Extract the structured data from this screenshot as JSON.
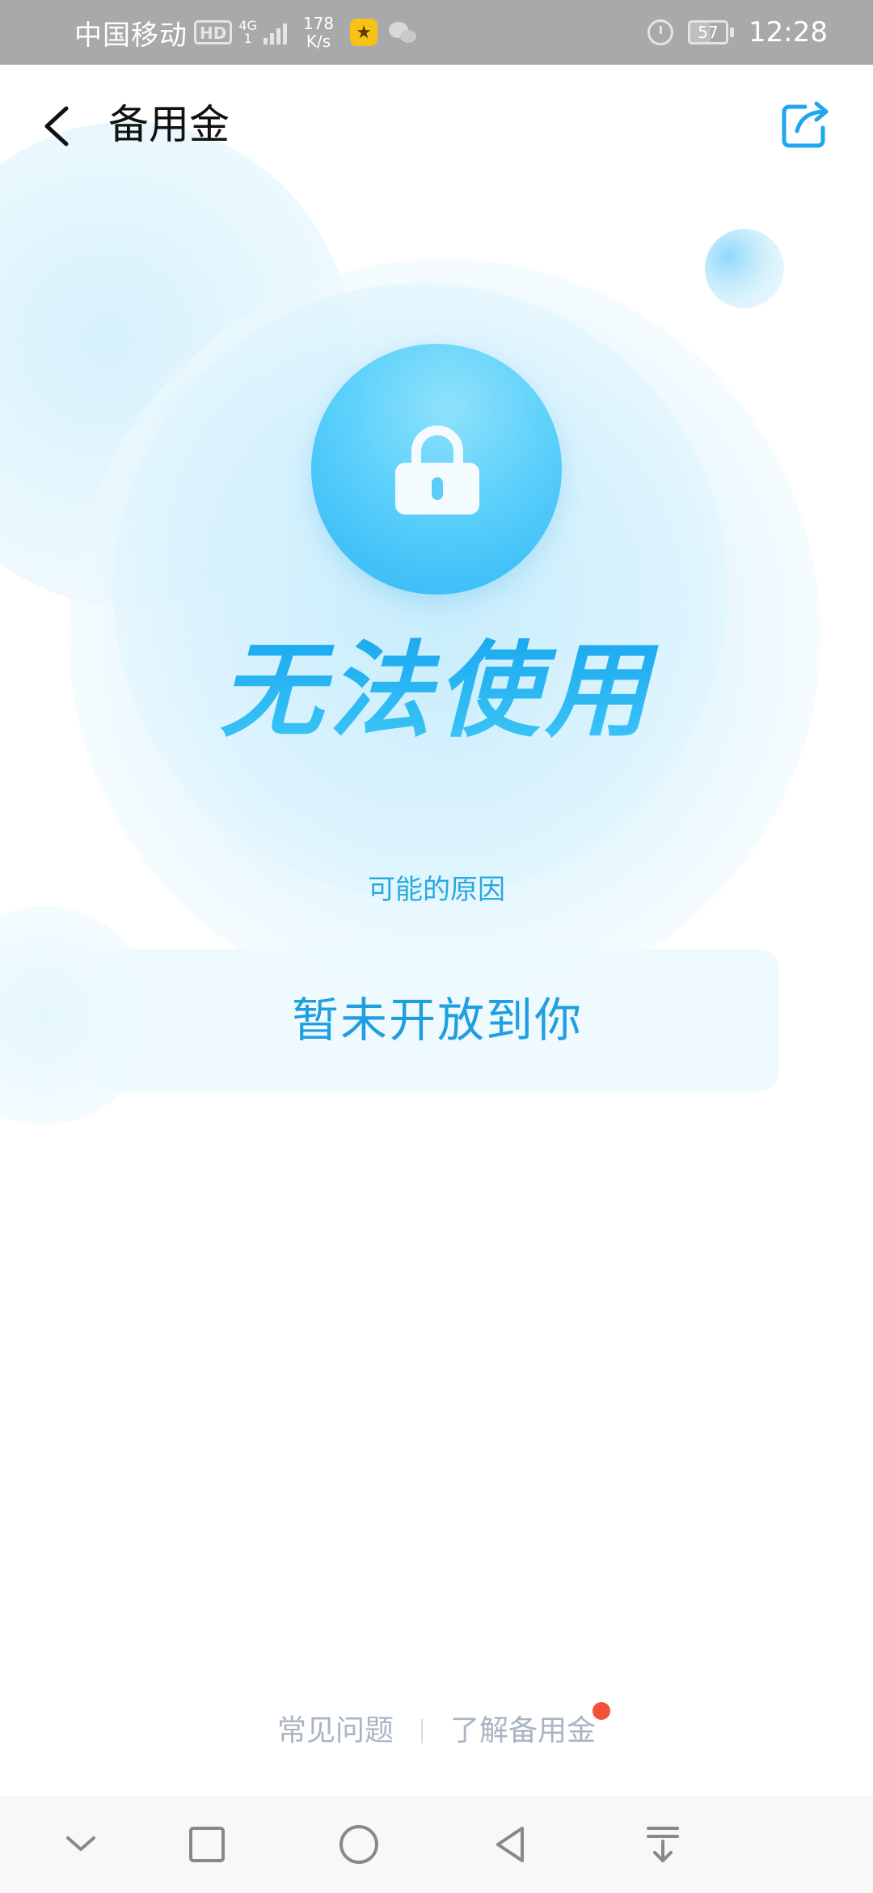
{
  "status_bar": {
    "carrier": "中国移动",
    "hd_badge": "HD",
    "network_type": "4G",
    "network_sub": "1",
    "speed_value": "178",
    "speed_unit": "K/s",
    "battery_level": "57",
    "time": "12:28"
  },
  "header": {
    "title": "备用金"
  },
  "main": {
    "headline": "无法使用",
    "reason_label": "可能的原因",
    "reason_text": "暂未开放到你"
  },
  "footer": {
    "faq_link": "常见问题",
    "learn_link": "了解备用金"
  },
  "colors": {
    "accent": "#2fb8f2",
    "status_bar_bg": "#a9a9ab",
    "reason_text": "#1f9fe0",
    "footer_link": "#a9b5c2",
    "badge_dot": "#f2513c"
  },
  "icons": {
    "back": "chevron-left-icon",
    "share": "share-icon",
    "lock": "lock-icon"
  }
}
